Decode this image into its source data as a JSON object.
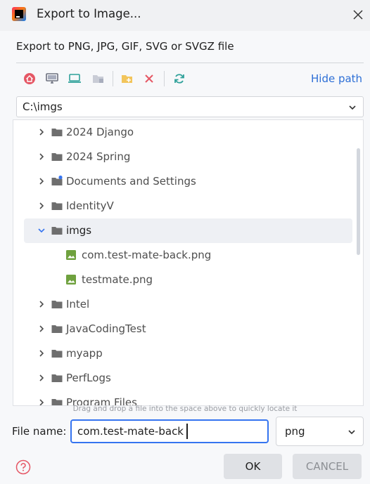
{
  "window": {
    "title": "Export to Image..."
  },
  "subtitle": "Export to PNG, JPG, GIF, SVG or SVGZ file",
  "toolbar": {
    "icons": [
      "home-icon",
      "desktop-icon",
      "project-icon",
      "module-icon",
      "new-folder-icon",
      "delete-icon",
      "refresh-icon"
    ],
    "hide_path": "Hide path"
  },
  "path": {
    "value": "C:\\imgs"
  },
  "tree": {
    "items": [
      {
        "label": "2024 Django",
        "type": "folder",
        "expanded": false
      },
      {
        "label": "2024 Spring",
        "type": "folder",
        "expanded": false
      },
      {
        "label": "Documents and Settings",
        "type": "folder-link",
        "expanded": false
      },
      {
        "label": "IdentityV",
        "type": "folder",
        "expanded": false
      },
      {
        "label": "imgs",
        "type": "folder",
        "expanded": true,
        "selected": true
      },
      {
        "label": "com.test-mate-back.png",
        "type": "image-file"
      },
      {
        "label": "testmate.png",
        "type": "image-file"
      },
      {
        "label": "Intel",
        "type": "folder",
        "expanded": false
      },
      {
        "label": "JavaCodingTest",
        "type": "folder",
        "expanded": false
      },
      {
        "label": "myapp",
        "type": "folder",
        "expanded": false
      },
      {
        "label": "PerfLogs",
        "type": "folder",
        "expanded": false
      },
      {
        "label": "Program Files",
        "type": "folder",
        "expanded": false
      }
    ]
  },
  "hint": "Drag and drop a file into the space above to quickly locate it",
  "file_name": {
    "label": "File name:",
    "value": "com.test-mate-back"
  },
  "file_type": {
    "value": "png"
  },
  "buttons": {
    "ok": "OK",
    "cancel": "CANCEL"
  },
  "colors": {
    "accent": "#3574f0",
    "link": "#2d6fd6",
    "folder": "#6e6e6e",
    "image_file": "#6fa13e"
  }
}
